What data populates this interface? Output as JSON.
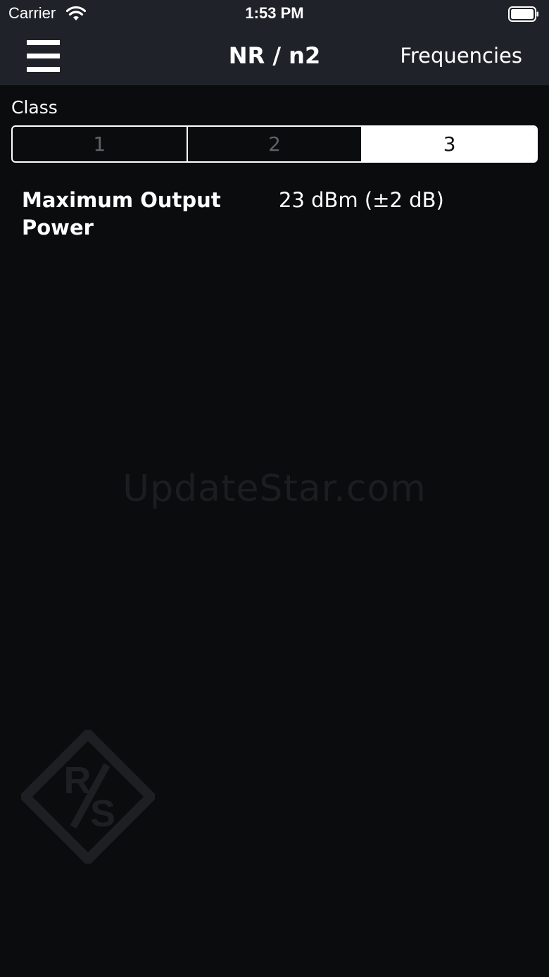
{
  "status_bar": {
    "carrier": "Carrier",
    "time": "1:53 PM"
  },
  "nav": {
    "title": "NR / n2",
    "right_button": "Frequencies"
  },
  "class_selector": {
    "label": "Class",
    "options": [
      "1",
      "2",
      "3"
    ],
    "selected": "3"
  },
  "spec": {
    "label": "Maximum Output Power",
    "value": "23 dBm (±2 dB)"
  },
  "watermark": "UpdateStar.com",
  "logo": {
    "text": "R/S"
  },
  "colors": {
    "header_bg": "#1f2329",
    "page_bg": "#0b0c0e",
    "selected_segment_bg": "#ffffff",
    "unselected_segment_text": "#5f6266",
    "logo_color": "#1e1f22"
  },
  "icons": [
    "wifi-icon",
    "battery-icon",
    "hamburger-menu-icon",
    "rs-logo-icon"
  ]
}
